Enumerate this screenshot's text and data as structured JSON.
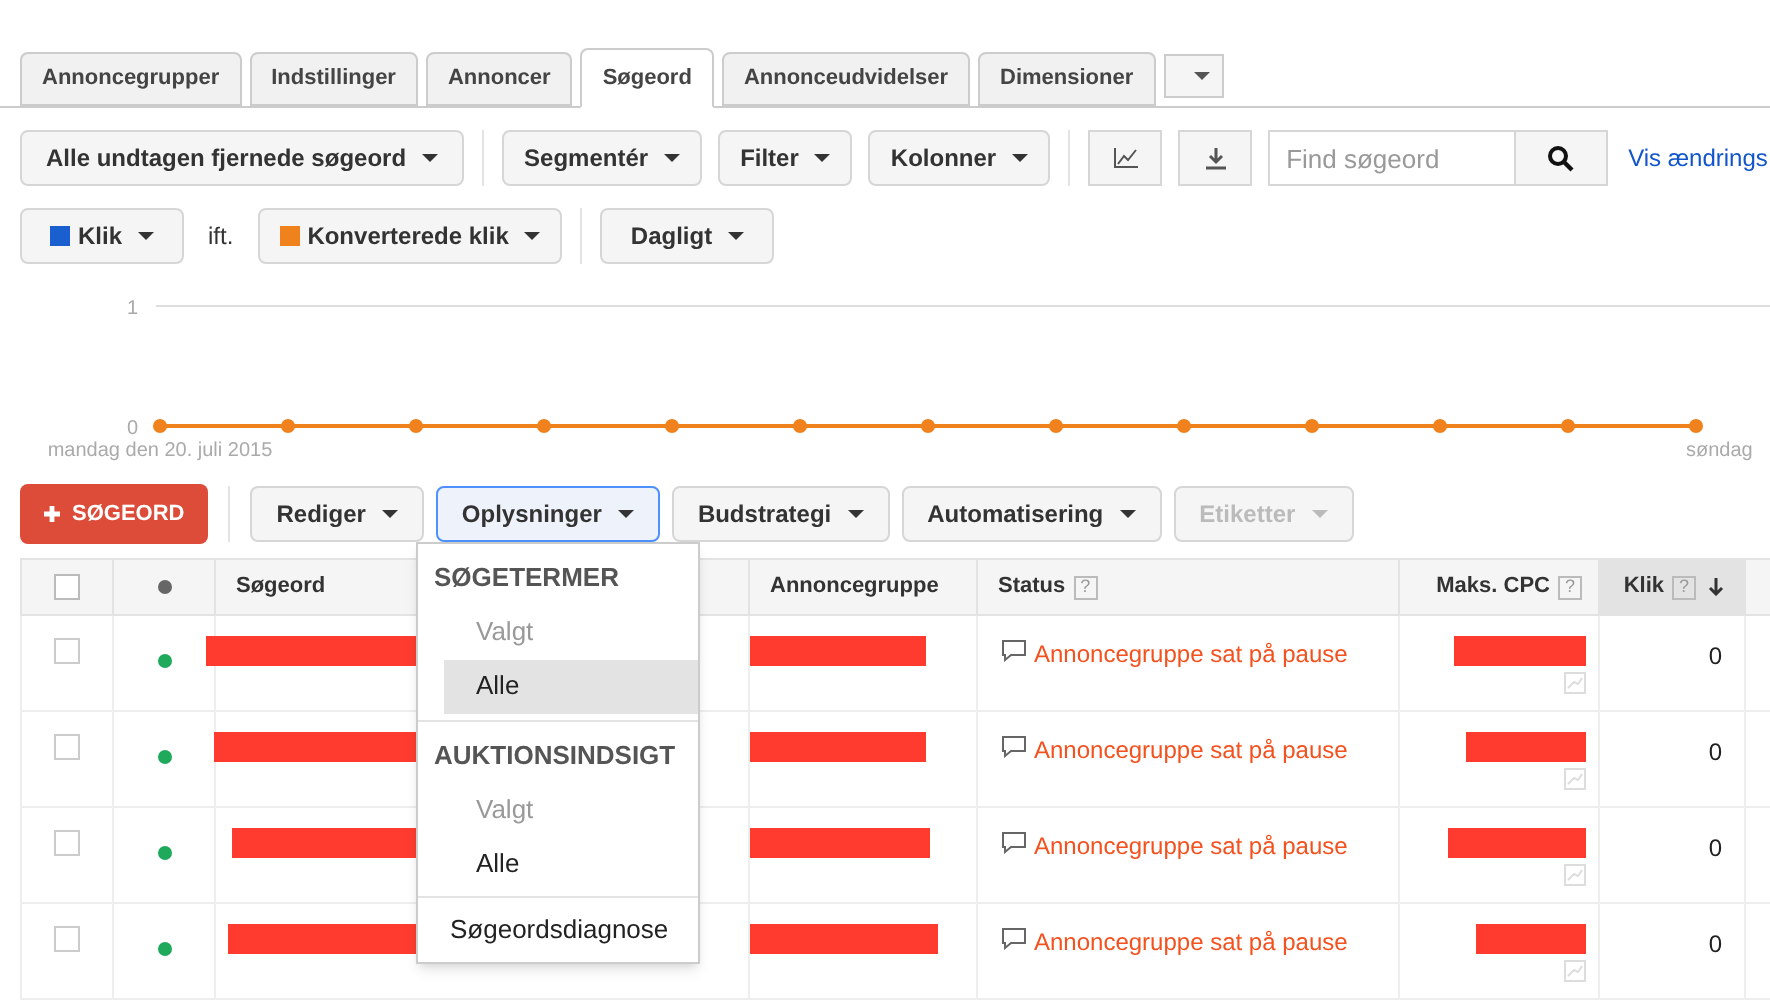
{
  "tabs": [
    {
      "label": "Annoncegrupper",
      "selected": false
    },
    {
      "label": "Indstillinger",
      "selected": false
    },
    {
      "label": "Annoncer",
      "selected": false
    },
    {
      "label": "Søgeord",
      "selected": true
    },
    {
      "label": "Annonceudvidelser",
      "selected": false
    },
    {
      "label": "Dimensioner",
      "selected": false
    }
  ],
  "toolbar": {
    "filter_buttons": [
      "Alle undtagen fjernede søgeord",
      "Segmentér",
      "Filter",
      "Kolonner"
    ],
    "search": {
      "placeholder": "Find søgeord"
    },
    "link": "Vis ændrings"
  },
  "metrics": {
    "primary": {
      "label": "Klik",
      "color": "#1a5fd0"
    },
    "versus": "ift.",
    "secondary": {
      "label": "Konverterede klik",
      "color": "#f0821e"
    },
    "period": "Dagligt"
  },
  "chart_data": {
    "type": "line",
    "categories": [
      "mandag den 20. juli 2015",
      null,
      null,
      null,
      null,
      null,
      null,
      null,
      null,
      null,
      null,
      null,
      "søndag"
    ],
    "yticks": [
      0,
      1
    ],
    "ylim": [
      0,
      1
    ],
    "series": [
      {
        "color": "#f0821e",
        "marker": "o",
        "values": [
          0,
          0,
          0,
          0,
          0,
          0,
          0,
          0,
          0,
          0,
          0,
          0,
          0
        ]
      }
    ]
  },
  "actions": {
    "add": "SØGEORD",
    "buttons": [
      {
        "label": "Rediger",
        "active": false,
        "disabled": false
      },
      {
        "label": "Oplysninger",
        "active": true,
        "disabled": false
      },
      {
        "label": "Budstrategi",
        "active": false,
        "disabled": false
      },
      {
        "label": "Automatisering",
        "active": false,
        "disabled": false
      },
      {
        "label": "Etiketter",
        "active": false,
        "disabled": true
      }
    ]
  },
  "table": {
    "select_all_checked": false,
    "columns": [
      {
        "label": "Søgeord",
        "sorted": false
      },
      {
        "label": "Annoncegruppe",
        "sorted": false
      },
      {
        "label": "Status",
        "help": "?",
        "sorted": false
      },
      {
        "label": "Maks. CPC",
        "help": "?",
        "sorted": false
      },
      {
        "label": "Klik",
        "help": "?",
        "sorted": true
      }
    ],
    "rows": [
      {
        "checked": false,
        "color": "#1fa95b",
        "status": "Annoncegruppe sat på pause",
        "clicks": "0"
      },
      {
        "checked": false,
        "color": "#1fa95b",
        "status": "Annoncegruppe sat på pause",
        "clicks": "0"
      },
      {
        "checked": false,
        "color": "#1fa95b",
        "status": "Annoncegruppe sat på pause",
        "clicks": "0"
      },
      {
        "checked": false,
        "color": "#1fa95b",
        "status": "Annoncegruppe sat på pause",
        "clicks": "0"
      }
    ]
  },
  "dropdown": {
    "items": [
      {
        "kind": "header",
        "label": "SØGETERMER"
      },
      {
        "kind": "option",
        "label": "Valgt",
        "disabled": true,
        "selected": false
      },
      {
        "kind": "option",
        "label": "Alle",
        "disabled": false,
        "selected": true
      },
      {
        "kind": "divider"
      },
      {
        "kind": "header",
        "label": "AUKTIONSINDSIGT"
      },
      {
        "kind": "option",
        "label": "Valgt",
        "disabled": true,
        "selected": false
      },
      {
        "kind": "option",
        "label": "Alle",
        "disabled": false,
        "selected": false
      },
      {
        "kind": "divider"
      },
      {
        "kind": "link",
        "label": "Søgeordsdiagnose"
      }
    ]
  }
}
